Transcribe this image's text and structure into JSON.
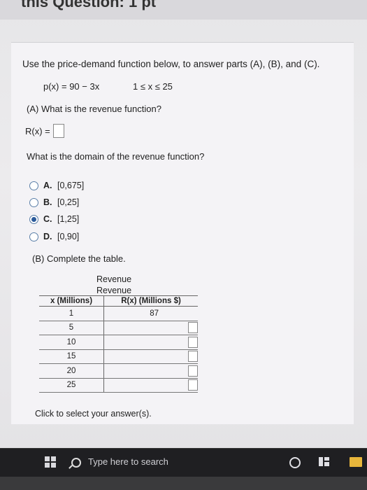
{
  "header": {
    "title_fragment": "this Question: 1 pt"
  },
  "question": {
    "intro": "Use the price-demand function below, to answer parts (A), (B), and (C).",
    "function": "p(x) = 90 − 3x",
    "domain": "1 ≤ x ≤ 25"
  },
  "partA": {
    "label": "(A) What is the revenue function?",
    "rx_label": "R(x) =",
    "domain_question": "What is the domain of the revenue function?",
    "options": [
      {
        "letter": "A.",
        "value": "[0,675]",
        "selected": false
      },
      {
        "letter": "B.",
        "value": "[0,25]",
        "selected": false
      },
      {
        "letter": "C.",
        "value": "[1,25]",
        "selected": true
      },
      {
        "letter": "D.",
        "value": "[0,90]",
        "selected": false
      }
    ]
  },
  "partB": {
    "label": "(B) Complete the table.",
    "header_line1": "Revenue",
    "header_line2": "Revenue",
    "col_x": "x (Millions)",
    "col_r": "R(x) (Millions $)",
    "rows": [
      {
        "x": "1",
        "r": "87"
      },
      {
        "x": "5",
        "r": ""
      },
      {
        "x": "10",
        "r": ""
      },
      {
        "x": "15",
        "r": ""
      },
      {
        "x": "20",
        "r": ""
      },
      {
        "x": "25",
        "r": ""
      }
    ]
  },
  "footer": {
    "click_note": "Click to select your answer(s)."
  },
  "taskbar": {
    "search_placeholder": "Type here to search",
    "icons": [
      "windows-start-icon",
      "search-icon",
      "cortana-icon",
      "task-view-icon",
      "file-explorer-icon"
    ]
  }
}
